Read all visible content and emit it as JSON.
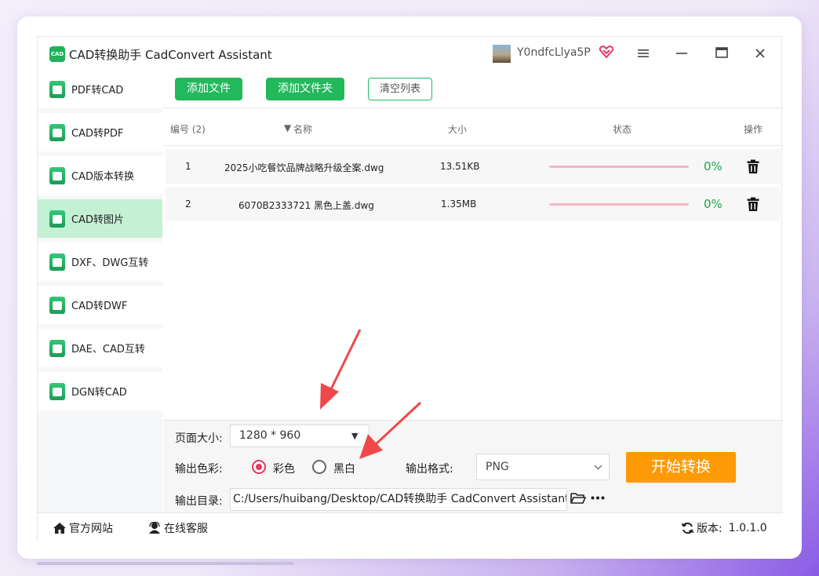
{
  "app": {
    "logo_text": "CAD",
    "title": "CAD转换助手 CadConvert Assistant",
    "username": "Y0ndfcLlya5P",
    "window_buttons": [
      "menu-icon",
      "minimize-icon",
      "maximize-icon",
      "close-icon"
    ]
  },
  "sidebar": {
    "items": [
      {
        "label": "PDF转CAD",
        "active": false
      },
      {
        "label": "CAD转PDF",
        "active": false
      },
      {
        "label": "CAD版本转换",
        "active": false
      },
      {
        "label": "CAD转图片",
        "active": true
      },
      {
        "label": "DXF、DWG互转",
        "active": false
      },
      {
        "label": "CAD转DWF",
        "active": false
      },
      {
        "label": "DAE、CAD互转",
        "active": false
      },
      {
        "label": "DGN转CAD",
        "active": false
      }
    ]
  },
  "toolbar": {
    "add_file": "添加文件",
    "add_folder": "添加文件夹",
    "clear_list": "清空列表"
  },
  "table": {
    "headers": {
      "index": "编号 (2)",
      "name": "名称",
      "size": "大小",
      "status": "状态",
      "action": "操作"
    },
    "rows": [
      {
        "index": "1",
        "name": "2025小吃餐饮品牌战略升级全案.dwg",
        "size": "13.51KB",
        "progress": 0,
        "percent": "0%"
      },
      {
        "index": "2",
        "name": "6070B2333721 黑色上盖.dwg",
        "size": "1.35MB",
        "progress": 0,
        "percent": "0%"
      }
    ]
  },
  "settings": {
    "page_size_label": "页面大小:",
    "page_size_value": "1280 * 960",
    "color_label": "输出色彩:",
    "color_option_color": "彩色",
    "color_option_bw": "黑白",
    "color_selected": "彩色",
    "format_label": "输出格式:",
    "format_value": "PNG",
    "start_button": "开始转换",
    "dir_label": "输出目录:",
    "dir_value": "C:/Users/huibang/Desktop/CAD转换助手 CadConvert Assistant"
  },
  "footer": {
    "website": "官方网站",
    "support": "在线客服",
    "version_label": "版本:",
    "version_value": "1.0.1.0"
  },
  "colors": {
    "accent_green": "#22b85c",
    "active_side": "#c4f0d4",
    "start_orange": "#fe9a05",
    "radio_red": "#e8385f",
    "percent_green": "#22a34a",
    "annotation_arrow": "#f04848"
  }
}
